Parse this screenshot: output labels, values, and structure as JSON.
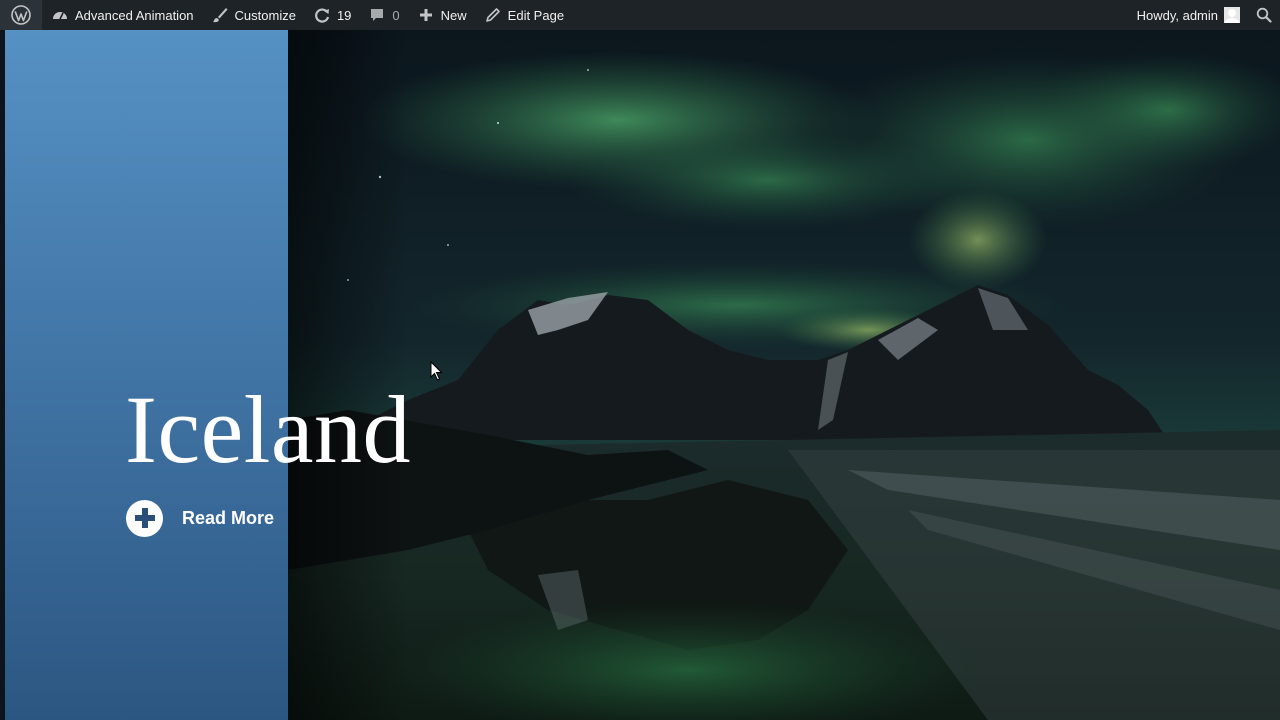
{
  "adminbar": {
    "site_name": "Advanced Animation",
    "customize": "Customize",
    "updates_count": "19",
    "comments_count": "0",
    "new": "New",
    "edit_page": "Edit Page",
    "howdy": "Howdy, admin"
  },
  "hero": {
    "title": "Iceland",
    "read_more": "Read More",
    "panel_color": "#4a82b6"
  },
  "icons": [
    "wordpress-logo-icon",
    "dashboard-icon",
    "brush-icon",
    "updates-icon",
    "comment-icon",
    "plus-icon",
    "pencil-icon",
    "avatar",
    "search-icon"
  ]
}
